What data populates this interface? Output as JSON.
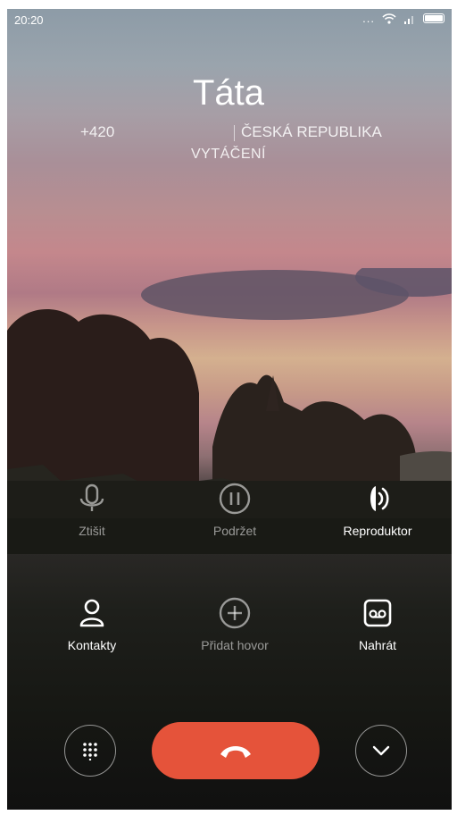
{
  "status_bar": {
    "time": "20:20",
    "dots": "...",
    "icons": [
      "wifi-icon",
      "signal-icon",
      "battery-icon"
    ]
  },
  "call": {
    "callee_name": "Táta",
    "phone_prefix": "+420",
    "country": "ČESKÁ REPUBLIKA",
    "status": "VYTÁČENÍ"
  },
  "actions_row1": [
    {
      "label": "Ztišit",
      "icon": "microphone-icon",
      "enabled": false
    },
    {
      "label": "Podržet",
      "icon": "pause-icon",
      "enabled": false
    },
    {
      "label": "Reproduktor",
      "icon": "speaker-icon",
      "enabled": true
    }
  ],
  "actions_row2": [
    {
      "label": "Kontakty",
      "icon": "contact-icon",
      "enabled": true
    },
    {
      "label": "Přidat hovor",
      "icon": "add-call-icon",
      "enabled": false
    },
    {
      "label": "Nahrát",
      "icon": "record-icon",
      "enabled": true
    }
  ],
  "bottom": {
    "dialpad": "dialpad-icon",
    "end_call": "hangup-icon",
    "collapse": "chevron-down-icon"
  },
  "colors": {
    "end_call": "#e5533a",
    "text": "#ffffff"
  }
}
